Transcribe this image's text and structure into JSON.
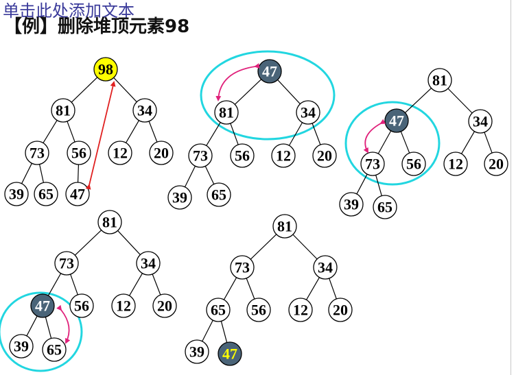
{
  "placeholder": "单击此处添加文本",
  "title": "【例】删除堆顶元素98",
  "colors": {
    "highlight_fill": "#ffff00",
    "moved_fill": "#4a6478",
    "moved_text": "#ffffff",
    "final_text": "#ffff00",
    "ring": "#22d6e0",
    "arrow_red": "#e02020",
    "arrow_magenta": "#e0207a"
  },
  "trees": [
    {
      "id": "step1",
      "nodes": [
        "98",
        "81",
        "34",
        "73",
        "56",
        "12",
        "20",
        "39",
        "65",
        "47"
      ],
      "styles": {
        "0": "highlight"
      }
    },
    {
      "id": "step2",
      "nodes": [
        "47",
        "81",
        "34",
        "73",
        "56",
        "12",
        "20",
        "39",
        "65"
      ],
      "styles": {
        "0": "moved"
      }
    },
    {
      "id": "step3",
      "nodes": [
        "81",
        "47",
        "34",
        "73",
        "56",
        "12",
        "20",
        "39",
        "65"
      ],
      "styles": {
        "1": "moved"
      }
    },
    {
      "id": "step4",
      "nodes": [
        "81",
        "73",
        "34",
        "47",
        "56",
        "12",
        "20",
        "39",
        "65"
      ],
      "styles": {
        "3": "moved"
      }
    },
    {
      "id": "step5",
      "nodes": [
        "81",
        "73",
        "34",
        "65",
        "56",
        "12",
        "20",
        "39",
        "47"
      ],
      "styles": {
        "8": "final"
      }
    }
  ]
}
